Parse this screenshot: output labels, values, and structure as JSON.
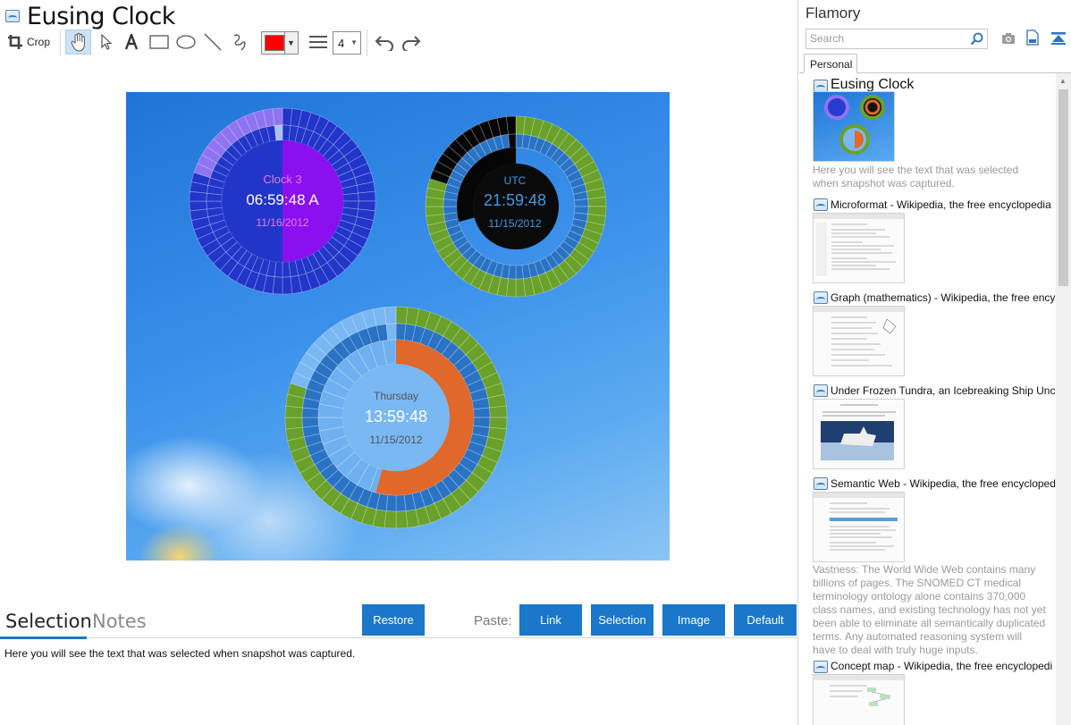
{
  "window": {
    "title": "Eusing Clock"
  },
  "toolbar": {
    "crop_label": "Crop",
    "current_color": "#ff0000",
    "line_width": "4",
    "tools": [
      "crop-icon",
      "hand-icon",
      "pointer-icon",
      "text-icon",
      "rectangle-icon",
      "ellipse-icon",
      "line-icon",
      "freehand-icon",
      "line-style-icon",
      "undo-icon",
      "redo-icon"
    ]
  },
  "screenshot": {
    "clocks": [
      {
        "name": "Clock 3",
        "time": "06:59:48 A",
        "date": "11/16/2012",
        "name_color": "#e879e8"
      },
      {
        "name": "UTC",
        "time": "21:59:48",
        "date": "11/15/2012",
        "name_color": "#3d9be8"
      },
      {
        "name": "Thursday",
        "time": "13:59:48",
        "date": "11/15/2012",
        "name_color": "#555555"
      }
    ]
  },
  "bottom": {
    "tabs": {
      "selection": "Selection",
      "notes": "Notes"
    },
    "restore": "Restore",
    "paste_label": "Paste:",
    "paste_buttons": [
      "Link",
      "Selection",
      "Image",
      "Default"
    ],
    "selection_text": "Here you will see the text that was selected when snapshot was captured."
  },
  "sidebar": {
    "title": "Flamory",
    "search_placeholder": "Search",
    "tab": "Personal",
    "entries": [
      {
        "title": "Eusing Clock",
        "description": "Here you will see the text that was selected when snapshot was captured."
      },
      {
        "title": "Microformat - Wikipedia, the free encyclopedia"
      },
      {
        "title": "Graph (mathematics) - Wikipedia, the free ency"
      },
      {
        "title": "Under Frozen Tundra, an Icebreaking Ship Unco"
      },
      {
        "title": "Semantic Web - Wikipedia, the free encycloped",
        "description": "Vastness: The World Wide Web contains many billions of pages. The SNOMED CT medical terminology ontology alone contains 370,000 class names, and existing technology has not yet been able to eliminate all semantically duplicated terms. Any automated reasoning system will have to deal with truly huge inputs."
      },
      {
        "title": "Concept map - Wikipedia, the free encyclopedi"
      }
    ]
  }
}
